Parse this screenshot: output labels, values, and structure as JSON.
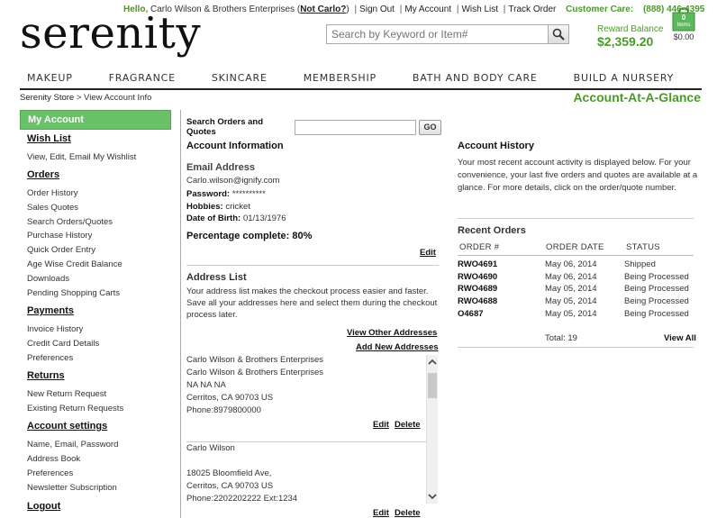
{
  "topbar": {
    "hello": "Hello,",
    "user_name": "Carlo Wilson & Brothers Enterprises",
    "open_paren": "(",
    "not_me": "Not Carlo?",
    "close_paren": ")",
    "sign_out": "Sign Out",
    "my_account": "My Account",
    "wish_list": "Wish List",
    "track_order": "Track Order",
    "customer_care_label": "Customer Care:",
    "customer_care_phone": "(888) 446-4395"
  },
  "logo": "serenity",
  "search": {
    "placeholder": "Search by Keyword or Item#"
  },
  "reward": {
    "label": "Reward Balance",
    "amount": "$2,359.20"
  },
  "cart": {
    "count": "0",
    "count_label": "Items",
    "total": "$0.00"
  },
  "nav": [
    "MAKEUP",
    "FRAGRANCE",
    "SKINCARE",
    "MEMBERSHIP",
    "BATH AND BODY CARE",
    "BUILD A NURSERY"
  ],
  "breadcrumb": {
    "store": "Serenity Store",
    "sep": ">",
    "current": "View Account Info"
  },
  "page_title": "Account-At-A-Glance",
  "sidebar": {
    "active": "My Account",
    "wish_list": "Wish List",
    "wish_list_desc": "View, Edit, Email My Wishlist",
    "orders": "Orders",
    "orders_links": [
      "Order History",
      "Sales Quotes",
      "Search Orders/Quotes",
      "Purchase History",
      "Quick Order Entry",
      "Age Wise Credit Balance",
      "Downloads",
      "Pending Shopping Carts"
    ],
    "payments": "Payments",
    "payments_links": [
      "Invoice History",
      "Credit Card Details",
      "Preferences"
    ],
    "returns": "Returns",
    "returns_links": [
      "New Return Request",
      "Existing Return Requests"
    ],
    "account_settings": "Account settings",
    "account_links": [
      "Name, Email, Password",
      "Address Book",
      "Preferences",
      "Newsletter Subscription"
    ],
    "logout": "Logout"
  },
  "search_orders": {
    "label": "Search Orders and Quotes",
    "value": "",
    "go": "GO"
  },
  "account_info": {
    "heading": "Account Information",
    "email_heading": "Email Address",
    "email": "Carlo.wilson@ignify.com",
    "password_label": "Password:",
    "password": "**********",
    "hobbies_label": "Hobbies:",
    "hobbies": "cricket",
    "dob_label": "Date of Birth:",
    "dob": "01/13/1976",
    "percentage": "Percentage complete: 80%",
    "edit": "Edit"
  },
  "address_list": {
    "heading": "Address List",
    "desc1": "Your address list makes the checkout process easier and faster.",
    "desc2": "Save all your addresses here and select them during the checkout",
    "desc3": "process later.",
    "view_other": "View Other Addresses",
    "add_new": "Add New Addresses",
    "addresses": [
      {
        "lines": [
          "Carlo Wilson & Brothers Enterprises",
          "Carlo Wilson & Brothers Enterprises",
          "NA NA NA",
          "Cerritos, CA 90703 US",
          "Phone:8979800000"
        ]
      },
      {
        "lines": [
          "Carlo Wilson",
          "",
          "18025 Bloomfield Ave,",
          "Cerritos, CA 90703 US",
          "Phone:2202202222 Ext:1234"
        ]
      }
    ],
    "edit": "Edit",
    "delete": "Delete"
  },
  "account_history": {
    "heading": "Account History",
    "desc1": "Your most recent account activity is displayed below. For your",
    "desc2": "convenience, your last five orders and quotes are available at a",
    "desc3": "glance. For more details, click on the order/quote number."
  },
  "recent_orders": {
    "heading": "Recent Orders",
    "columns": [
      "ORDER #",
      "ORDER DATE",
      "STATUS"
    ],
    "rows": [
      [
        "RWO4691",
        "May 06, 2014",
        "Shipped"
      ],
      [
        "RWO4690",
        "May 06, 2014",
        "Being Processed"
      ],
      [
        "RWO4689",
        "May 05, 2014",
        "Being Processed"
      ],
      [
        "RWO4688",
        "May 05, 2014",
        "Being Processed"
      ],
      [
        "O4687",
        "May 05, 2014",
        "Being Processed"
      ]
    ],
    "total": "Total: 19",
    "view_all": "View All"
  },
  "colors": {
    "accent_green": "#4a9a2a",
    "active_bg": "#6abf69"
  }
}
